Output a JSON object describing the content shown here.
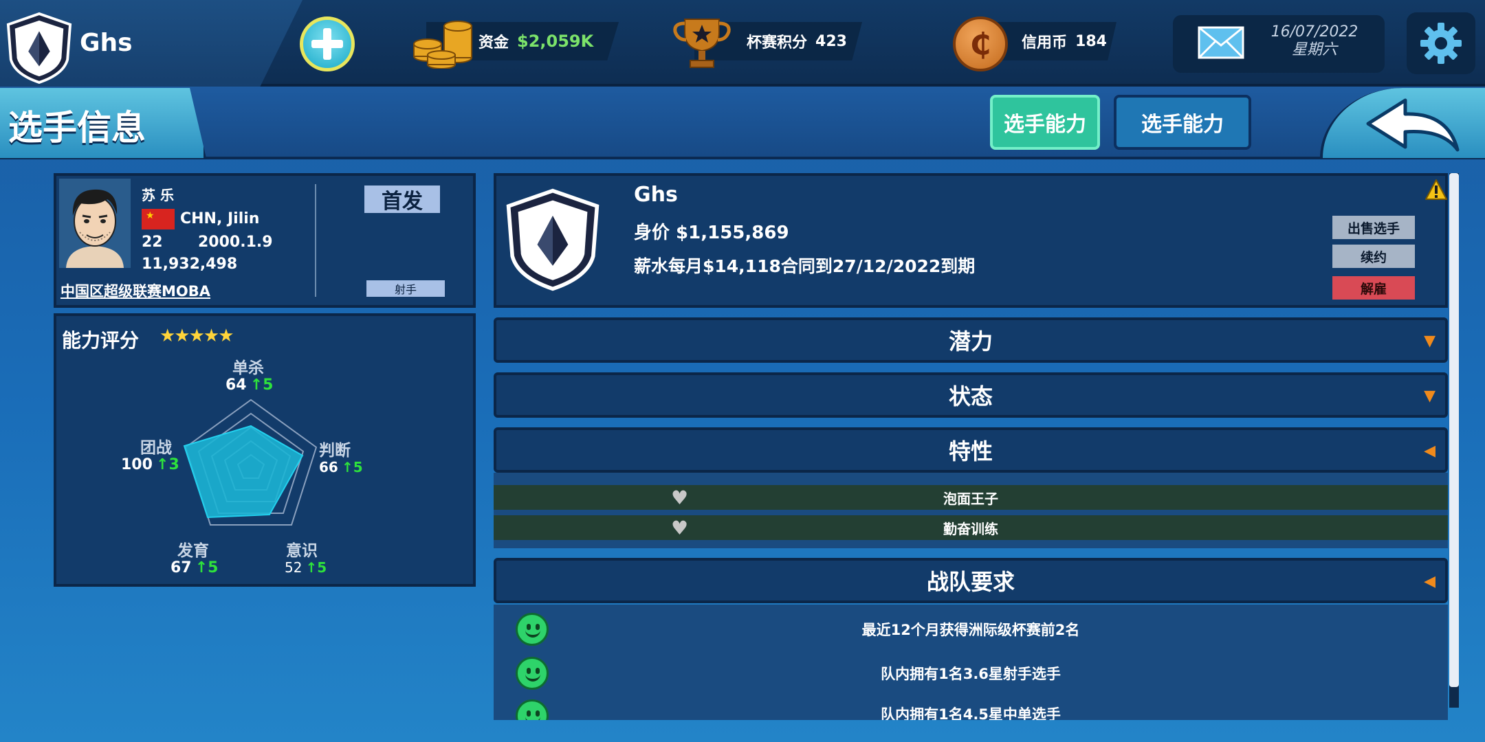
{
  "topbar": {
    "team_name": "Ghs",
    "funds_label": "资金",
    "funds_value": "$2,059K",
    "cup_label": "杯赛积分",
    "cup_value": "423",
    "credit_label": "信用币",
    "credit_value": "184",
    "credit_symbol": "₵",
    "date": "16/07/2022",
    "weekday": "星期六",
    "icons": [
      "team-crest-icon",
      "plus-icon",
      "coins-icon",
      "trophy-icon",
      "credit-coin-icon",
      "mail-icon",
      "gear-icon"
    ]
  },
  "header": {
    "title": "选手信息",
    "tabs": [
      {
        "label": "选手能力",
        "active": true
      },
      {
        "label": "选手能力",
        "active": false
      }
    ]
  },
  "profile": {
    "name": "苏 乐",
    "nationality": "CHN,  Jilin",
    "age": "22",
    "birth": "2000.1.9",
    "number": "11,932,498",
    "league": "中国区超级联赛MOBA",
    "lineup": "首发",
    "role": "射手"
  },
  "rating": {
    "title": "能力评分",
    "stars": "★★★★★",
    "stats": [
      {
        "label": "单杀",
        "value": "64",
        "gain": "↑5"
      },
      {
        "label": "判断",
        "value": "66",
        "gain": "↑5"
      },
      {
        "label": "意识",
        "value": "52",
        "gain": "↑5"
      },
      {
        "label": "发育",
        "value": "67",
        "gain": "↑5"
      },
      {
        "label": "团战",
        "value": "100",
        "gain": "↑3"
      }
    ]
  },
  "club": {
    "name": "Ghs",
    "market_value": "身价  $1,155,869",
    "contract": "薪水每月$14,118合同到27/12/2022到期",
    "sell_label": "出售选手",
    "renew_label": "续约",
    "release_label": "解雇"
  },
  "sections": {
    "potential": "潜力",
    "status": "状态",
    "traits": "特性",
    "team_requirements": "战队要求"
  },
  "traits": [
    "泡面王子",
    "勤奋训练"
  ],
  "requirements": [
    "最近12个月获得洲际级杯赛前2名",
    "队内拥有1名3.6星射手选手",
    "队内拥有1名4.5星中单选手"
  ],
  "colors": {
    "accent_green": "#2fc49d",
    "funds_green": "#7ce36a",
    "gain_green": "#2ee23c",
    "release_red": "#d94a55",
    "star_gold": "#ffd43a"
  }
}
